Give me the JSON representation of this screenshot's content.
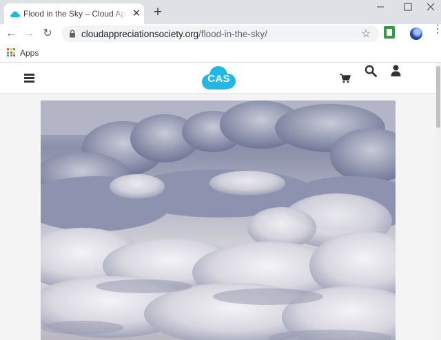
{
  "browser": {
    "tab": {
      "title": "Flood in the Sky – Cloud Appreciation Society",
      "favicon": "cloud-icon",
      "close_glyph": "✕"
    },
    "new_tab_glyph": "+",
    "window_controls": [
      "minimize-icon",
      "maximize-icon",
      "close-icon"
    ],
    "toolbar": {
      "back_glyph": "←",
      "forward_glyph": "→",
      "reload_glyph": "↻",
      "url_domain": "cloudappreciationsociety.org",
      "url_path": "/flood-in-the-sky/",
      "bookmark_glyph": "☆",
      "menu_glyph": "⋮"
    },
    "bookmarks_bar": {
      "apps_label": "Apps",
      "apps_dot_colors": [
        "#ea4335",
        "#fbbc05",
        "#34a853",
        "#4285f4",
        "#ea4335",
        "#fbbc05",
        "#34a853",
        "#4285f4",
        "#ea4335"
      ]
    }
  },
  "site": {
    "logo_text": "CAS",
    "brand_color": "#22b8e6",
    "header_icons": [
      "menu-icon",
      "cart-icon",
      "search-icon",
      "user-icon"
    ]
  }
}
